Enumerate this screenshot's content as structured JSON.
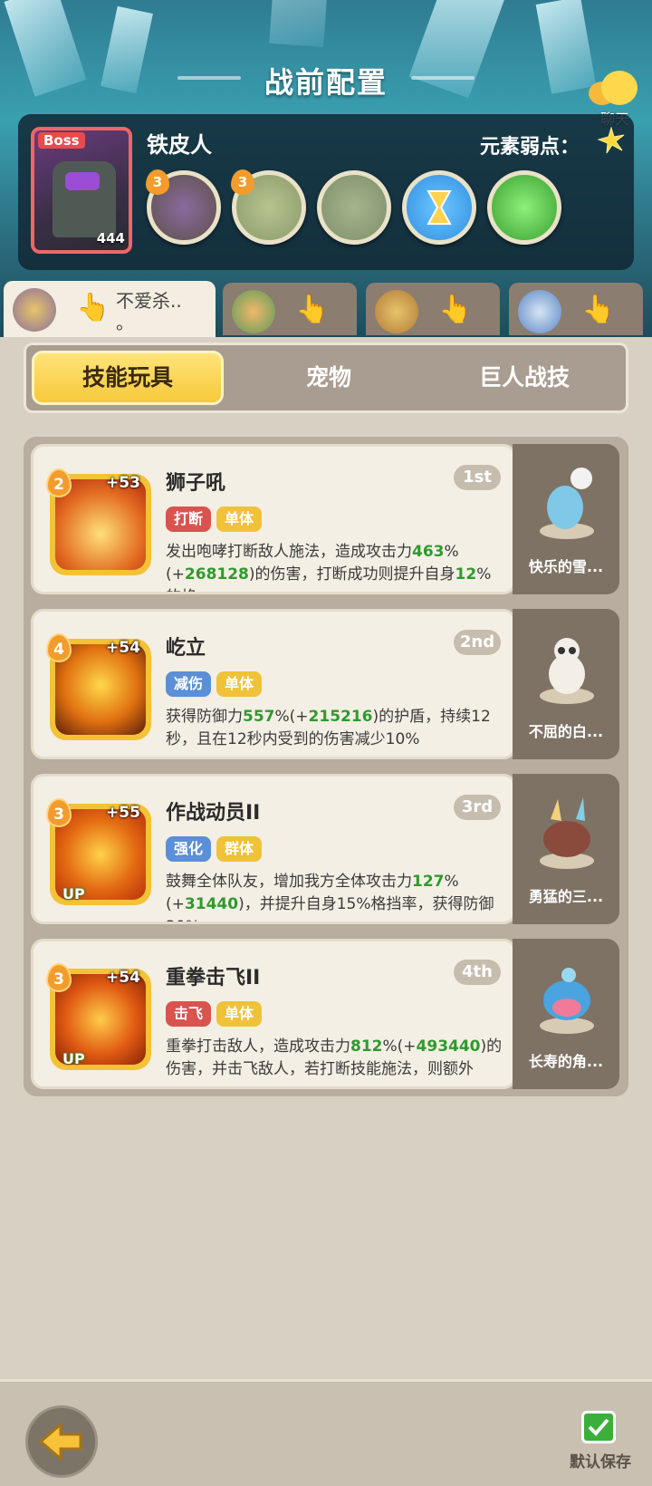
{
  "header": {
    "title": "战前配置",
    "chat_label": "聊天"
  },
  "boss": {
    "tag": "Boss",
    "level": "444",
    "name": "铁皮人",
    "weakness_label": "元素弱点：",
    "weakness_icon": "star-burst-icon",
    "skills": [
      {
        "badge": "3",
        "icon": "iron-armor-skill-icon",
        "color": "#5c5148"
      },
      {
        "badge": "3",
        "icon": "iron-face-skill-icon",
        "color": "#8b9a6a"
      },
      {
        "badge": "",
        "icon": "iron-head-skill-icon",
        "color": "#7d8f6c"
      },
      {
        "badge": "",
        "icon": "hourglass-skill-icon",
        "color": "#2f8fe0"
      },
      {
        "badge": "",
        "icon": "green-slime-skill-icon",
        "color": "#4cbf3c"
      }
    ]
  },
  "hero_tabs": [
    {
      "text": "不爱杀..",
      "text2": "。",
      "icon": "hero-avatar-1",
      "active": true
    },
    {
      "text": "",
      "icon": "hero-avatar-2",
      "active": false
    },
    {
      "text": "",
      "icon": "hero-avatar-3",
      "active": false
    },
    {
      "text": "",
      "icon": "hero-avatar-4",
      "active": false
    }
  ],
  "main_tabs": [
    {
      "label": "技能玩具",
      "active": true
    },
    {
      "label": "宠物",
      "active": false
    },
    {
      "label": "巨人战技",
      "active": false
    }
  ],
  "skills": [
    {
      "name": "狮子吼",
      "rank": "1st",
      "level": "2",
      "plus": "+53",
      "up": "",
      "tags": [
        {
          "text": "打断",
          "color": "red"
        },
        {
          "text": "单体",
          "color": "yellow"
        }
      ],
      "desc_parts": [
        "发出咆哮打断敌人施法，造成攻击力",
        "463",
        "%(+",
        "2",
        "",
        "68128",
        ")的伤害，打断成功则提升自身",
        "12",
        "%的格",
        "..."
      ],
      "pet_name": "快乐的雪..."
    },
    {
      "name": "屹立",
      "rank": "2nd",
      "level": "4",
      "plus": "+54",
      "up": "",
      "tags": [
        {
          "text": "减伤",
          "color": "blue"
        },
        {
          "text": "单体",
          "color": "yellow"
        }
      ],
      "desc_parts": [
        "获得防御力",
        "557",
        "%(+",
        "215216",
        ")的护盾，持续12秒",
        "，且在12秒内受到的伤害减少10%"
      ],
      "pet_name": "不屈的白..."
    },
    {
      "name": "作战动员II",
      "rank": "3rd",
      "level": "3",
      "plus": "+55",
      "up": "UP",
      "tags": [
        {
          "text": "强化",
          "color": "blue"
        },
        {
          "text": "群体",
          "color": "yellow"
        }
      ],
      "desc_parts": [
        "鼓舞全体队友，增加我方全体攻击力",
        "127",
        "%(+",
        "31",
        "440",
        ")，并提升自身15%格挡率，获得防御30%",
        "..."
      ],
      "pet_name": "勇猛的三..."
    },
    {
      "name": "重拳击飞II",
      "rank": "4th",
      "level": "3",
      "plus": "+54",
      "up": "UP",
      "tags": [
        {
          "text": "击飞",
          "color": "red"
        },
        {
          "text": "单体",
          "color": "yellow"
        }
      ],
      "desc_parts": [
        "重拳打击敌人，造成攻击力",
        "812",
        "%(+",
        "493440",
        ")的",
        "伤害，并击飞敌人，若打断技能施法，则额外",
        "..."
      ],
      "pet_name": "长寿的角..."
    }
  ],
  "bottom": {
    "back_icon": "back-arrow-icon",
    "save_label": "默认保存",
    "save_icon": "check-icon"
  },
  "colors": {
    "accent_yellow": "#f7c93a",
    "highlight_green": "#2e9a2e",
    "tag_red": "#d9534f",
    "tag_blue": "#5b8fd6"
  }
}
